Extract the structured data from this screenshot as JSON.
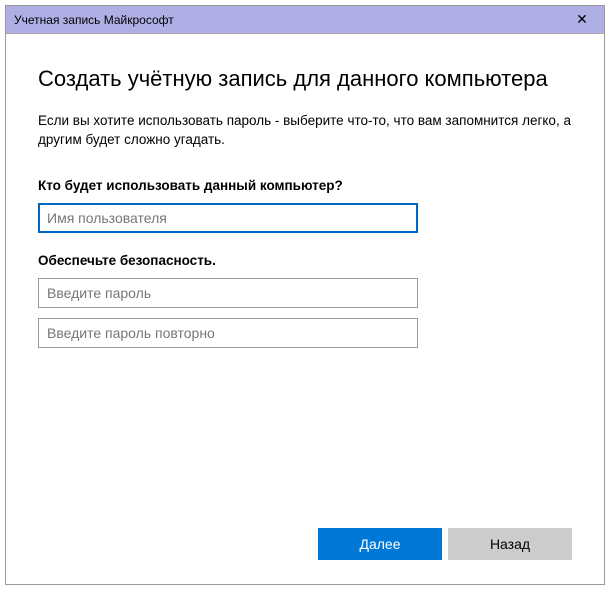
{
  "titlebar": {
    "title": "Учетная запись Майкрософт",
    "close_symbol": "✕"
  },
  "main": {
    "heading": "Создать учётную запись для данного компьютера",
    "description": "Если вы хотите использовать пароль - выберите что-то, что вам запомнится легко, а другим будет сложно угадать.",
    "username_section_label": "Кто будет использовать данный компьютер?",
    "username_placeholder": "Имя пользователя",
    "security_section_label": "Обеспечьте безопасность.",
    "password_placeholder": "Введите пароль",
    "password_confirm_placeholder": "Введите пароль повторно"
  },
  "buttons": {
    "next": "Далее",
    "back": "Назад"
  }
}
